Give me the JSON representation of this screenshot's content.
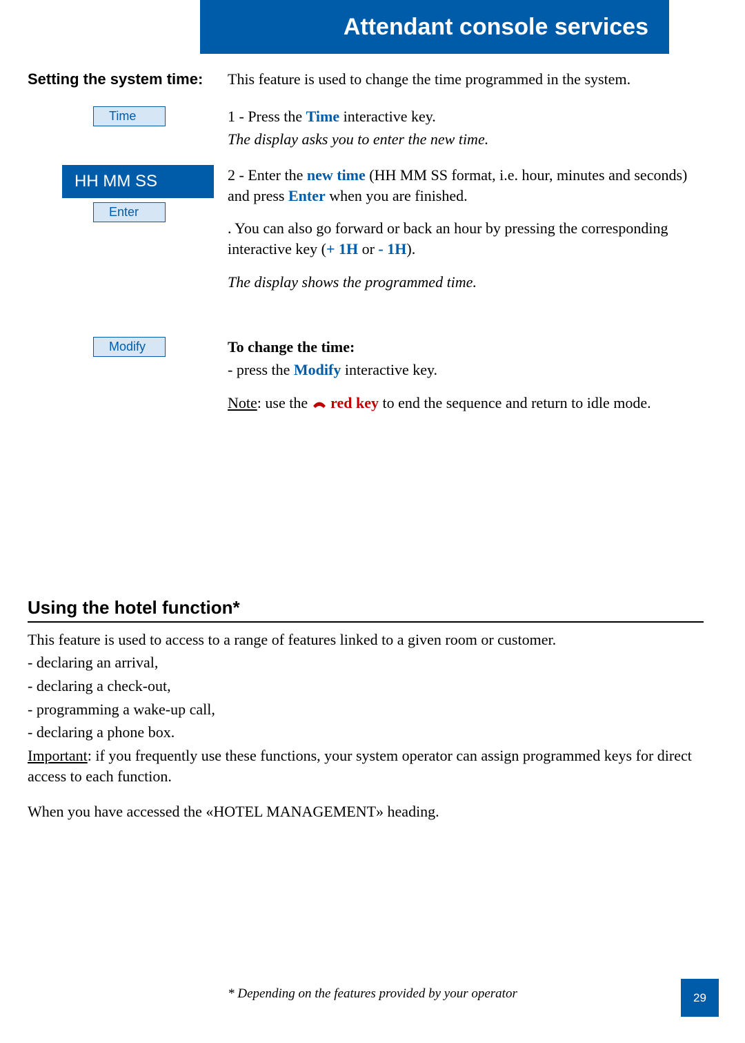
{
  "header": {
    "title": "Attendant console services"
  },
  "section1": {
    "label": "Setting the system time:",
    "intro": "This feature is used to change the time programmed in the system.",
    "keys": {
      "time": "Time",
      "enter": "Enter",
      "modify": "Modify"
    },
    "display": "HH MM SS",
    "step1_prefix": "1 - Press the ",
    "step1_key": "Time",
    "step1_suffix": " interactive key.",
    "step1_result": "The display asks you to enter the new time.",
    "step2_prefix": "2 - Enter the ",
    "step2_key": "new time",
    "step2_mid": " (HH MM SS format, i.e. hour, minutes and seconds) and press ",
    "step2_key2": "Enter",
    "step2_suffix": " when you are finished.",
    "step2_alt_prefix": ". You can also go forward or back an hour by pressing the corresponding interactive key (",
    "step2_alt_k1": "+ 1H",
    "step2_alt_mid": " or ",
    "step2_alt_k2": "- 1H",
    "step2_alt_suffix": ").",
    "step2_result": "The display shows the programmed time.",
    "change_heading": "To change the time:",
    "change_line_prefix": "- press the ",
    "change_key": "Modify",
    "change_line_suffix": " interactive key.",
    "note_label": "Note",
    "note_prefix": ": use the ",
    "note_key": " red key",
    "note_suffix": " to end the sequence and return to idle mode."
  },
  "section2": {
    "title": "Using the hotel function*",
    "intro": "This feature is used to access to a range of features linked to a given room or customer.",
    "items": [
      "- declaring an arrival,",
      "- declaring a check-out,",
      "- programming a wake-up call,",
      "- declaring a phone box."
    ],
    "important_label": "Important",
    "important_text": ": if you frequently use these functions, your system operator can assign programmed keys for direct access to each function.",
    "final": "When you have accessed the «HOTEL MANAGEMENT» heading."
  },
  "footnote": "* Depending on the features provided by your operator",
  "page_number": "29"
}
